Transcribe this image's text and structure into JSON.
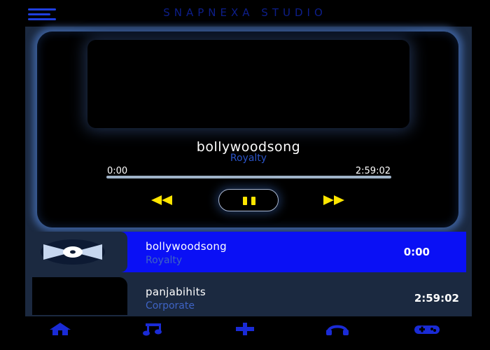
{
  "app": {
    "title": "SNAPNEXA STUDIO"
  },
  "now_playing": {
    "title": "bollywoodsong",
    "artist": "Royalty",
    "current_time": "0:00",
    "duration": "2:59:02",
    "progress": 0
  },
  "tracks": [
    {
      "title": "bollywoodsong",
      "artist": "Royalty",
      "time": "0:00",
      "active": true
    },
    {
      "title": "panjabihits",
      "artist": "Corporate",
      "time": "2:59:02",
      "active": false
    }
  ],
  "controls": {
    "rewind_icon": "rewind-icon",
    "pause_icon": "pause-icon",
    "forward_icon": "fast-forward-icon"
  },
  "nav": {
    "items": [
      {
        "icon": "home-icon"
      },
      {
        "icon": "music-note-icon"
      },
      {
        "icon": "plus-icon"
      },
      {
        "icon": "headphones-icon"
      },
      {
        "icon": "gamepad-icon"
      }
    ]
  },
  "colors": {
    "accent": "#0a10f5",
    "nav_icon": "#1a2bd6",
    "control": "#ffe600",
    "panel": "#1b2940",
    "artist_text": "#2a53c6"
  }
}
